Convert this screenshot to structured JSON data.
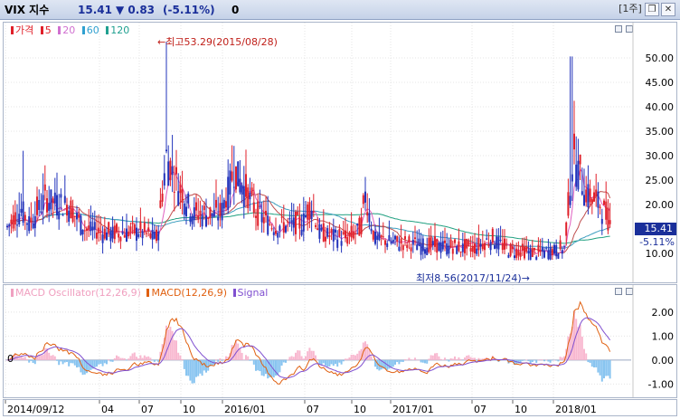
{
  "header": {
    "symbol": "VIX 지수",
    "price": "15.41",
    "change": "▼ 0.83",
    "change_pct": "(-5.11%)",
    "volume": "0",
    "period_button": "[1주]",
    "restore_label": "❐",
    "close_label": "✕"
  },
  "price_panel": {
    "legend": {
      "price": "가격",
      "ma5": "5",
      "ma20": "20",
      "ma60": "60",
      "ma120": "120"
    },
    "max_annotation": "←최고53.29(2015/08/28)",
    "min_annotation": "최저8.56(2017/11/24)→",
    "y_ticks": [
      "50.00",
      "45.00",
      "40.00",
      "35.00",
      "30.00",
      "25.00",
      "20.00",
      "10.00"
    ],
    "current_price_label": "15.41",
    "current_change_label": "-5.11%"
  },
  "macd_panel": {
    "legend": {
      "oscillator": "MACD Oscillator(12,26,9)",
      "macd": "MACD(12,26,9)",
      "signal": "Signal"
    },
    "y_ticks": [
      "2.00",
      "1.00",
      "0.00",
      "-1.00"
    ],
    "zero_label": "0"
  },
  "x_axis": {
    "labels": [
      "2014/09/12",
      "04",
      "07",
      "10",
      "2016/01",
      "07",
      "10",
      "2017/01",
      "07",
      "10",
      "2018/01"
    ]
  },
  "colors": {
    "up_candle": "#e0202a",
    "down_candle": "#2233bb",
    "ma5": "#e060c0",
    "ma20": "#c05050",
    "ma60": "#40a0c0",
    "ma120": "#20a080",
    "macd": "#e06010",
    "signal": "#8050d0",
    "osc_pos": "#f8b8d0",
    "osc_neg": "#88c4f0"
  },
  "chart_data": {
    "type": "line",
    "title": "VIX 지수",
    "x": [
      "2014/09/12",
      "04",
      "07",
      "10",
      "2016/01",
      "07",
      "10",
      "2017/01",
      "07",
      "10",
      "2018/01"
    ],
    "series": [
      {
        "name": "가격",
        "values": [
          14.5,
          17.0,
          14.0,
          22.0,
          21.0,
          15.5,
          14.0,
          12.5,
          11.5,
          10.0,
          17.0,
          15.41
        ]
      }
    ],
    "annotations": {
      "high": 53.29,
      "high_date": "2015/08/28",
      "low": 8.56,
      "low_date": "2017/11/24"
    },
    "ylim": [
      8,
      53
    ],
    "macd_ylim": [
      -1.4,
      2.6
    ]
  }
}
